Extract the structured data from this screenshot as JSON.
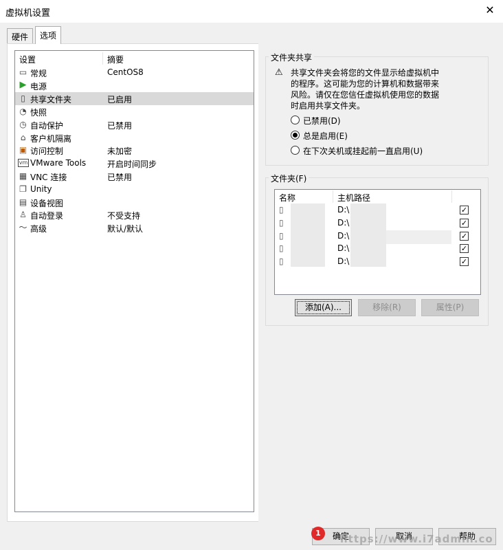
{
  "window": {
    "title": "虚拟机设置"
  },
  "tabs": [
    {
      "label": "硬件"
    },
    {
      "label": "选项"
    }
  ],
  "settings_list": {
    "columns": [
      "设置",
      "摘要"
    ],
    "items": [
      {
        "name": "常规",
        "summary": "CentOS8",
        "icon": "monitor-icon"
      },
      {
        "name": "电源",
        "summary": "",
        "icon": "play-icon"
      },
      {
        "name": "共享文件夹",
        "summary": "已启用",
        "icon": "shared-folder-icon"
      },
      {
        "name": "快照",
        "summary": "",
        "icon": "snapshot-icon"
      },
      {
        "name": "自动保护",
        "summary": "已禁用",
        "icon": "clock-icon"
      },
      {
        "name": "客户机隔离",
        "summary": "",
        "icon": "lock-icon"
      },
      {
        "name": "访问控制",
        "summary": "未加密",
        "icon": "access-control-icon"
      },
      {
        "name": "VMware Tools",
        "summary": "开启时间同步",
        "icon": "vm-icon"
      },
      {
        "name": "VNC 连接",
        "summary": "已禁用",
        "icon": "vnc-icon"
      },
      {
        "name": "Unity",
        "summary": "",
        "icon": "unity-icon"
      },
      {
        "name": "设备视图",
        "summary": "",
        "icon": "device-view-icon"
      },
      {
        "name": "自动登录",
        "summary": "不受支持",
        "icon": "users-icon"
      },
      {
        "name": "高级",
        "summary": "默认/默认",
        "icon": "advanced-icon"
      }
    ]
  },
  "folder_sharing": {
    "label": "文件夹共享",
    "warning_lines": [
      "共享文件夹会将您的文件显示给虚拟机中",
      "的程序。这可能为您的计算机和数据带来",
      "风险。请仅在您信任虚拟机使用您的数据",
      "时启用共享文件夹。"
    ],
    "options": [
      {
        "label": "已禁用(D)",
        "selected": false
      },
      {
        "label": "总是启用(E)",
        "selected": true
      },
      {
        "label": "在下次关机或挂起前一直启用(U)",
        "selected": false
      }
    ]
  },
  "folders": {
    "label": "文件夹(F)",
    "columns": [
      "名称",
      "主机路径"
    ],
    "rows": [
      {
        "path": "D:\\",
        "checked": true
      },
      {
        "path": "D:\\",
        "checked": true
      },
      {
        "path": "D:\\",
        "checked": true
      },
      {
        "path": "D:\\",
        "checked": true
      },
      {
        "path": "D:\\",
        "checked": true
      }
    ],
    "buttons": {
      "add": "添加(A)...",
      "remove": "移除(R)",
      "properties": "属性(P)"
    }
  },
  "footer": {
    "badge": "1",
    "ok": "确定",
    "cancel": "取消",
    "help": "帮助",
    "watermark": "https://www.i7admin.co"
  },
  "colors": {
    "selected_row": "#d9d9d9",
    "badge": "#e02a2a",
    "focus_border": "#0078d7",
    "power_green": "#2aa12a"
  }
}
